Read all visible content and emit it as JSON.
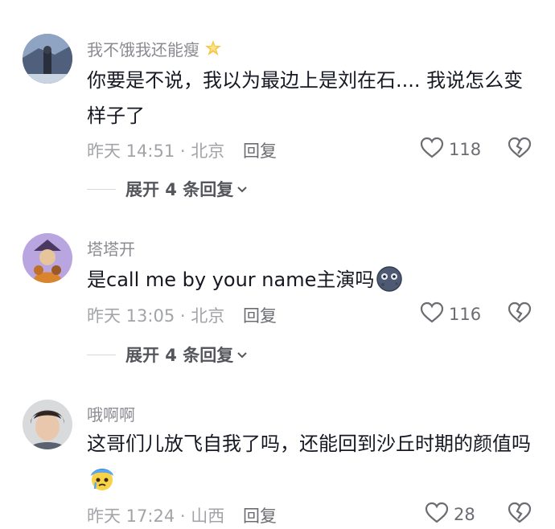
{
  "comments": [
    {
      "username": "我不饿我还能瘦",
      "text": "你要是不说，我以为最边上是刘在石.... 我说怎么变样子了",
      "time": "昨天 14:51 · 北京",
      "reply_label": "回复",
      "likes": "118",
      "expand_label": "展开 4 条回复",
      "badge_icon": "sparkle-crown-icon"
    },
    {
      "username": "塔塔开",
      "text": "是call me by your name主演吗",
      "time": "昨天 13:05 · 北京",
      "reply_label": "回复",
      "likes": "116",
      "expand_label": "展开 4 条回复",
      "emoji_icon": "blue-moon-face-icon"
    },
    {
      "username": "哦啊啊",
      "text": "这哥们儿放飞自我了吗，还能回到沙丘时期的颜值吗",
      "time": "昨天 17:24 · 山西",
      "reply_label": "回复",
      "likes": "28",
      "emoji_icon": "crying-face-icon"
    }
  ],
  "colors": {
    "text_primary": "#161823",
    "text_secondary": "#8a8b91",
    "meta": "#a3a4a8"
  }
}
